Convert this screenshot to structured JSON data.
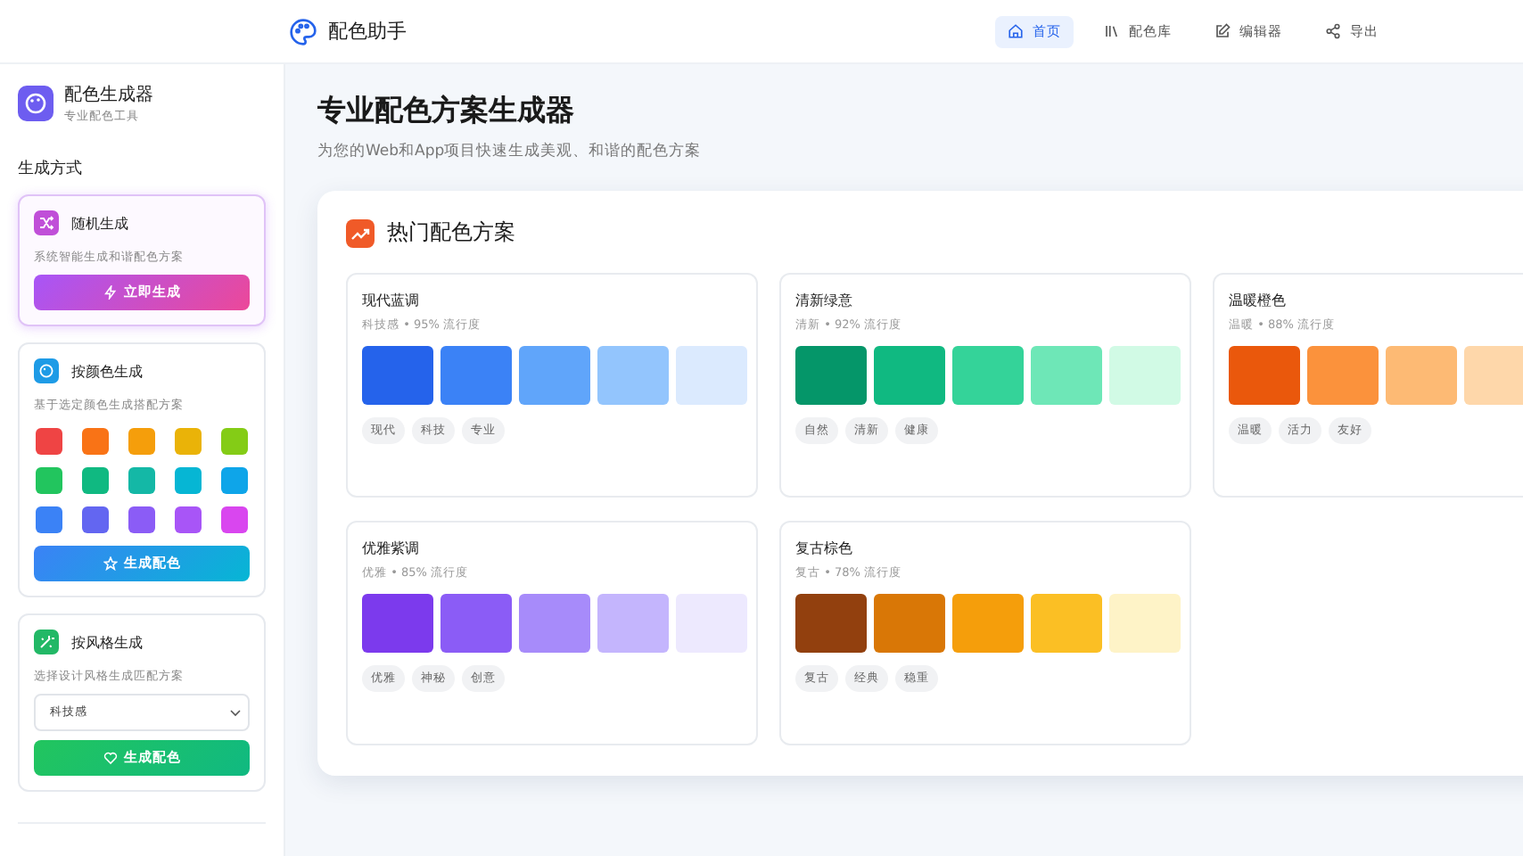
{
  "nav": {
    "brand": "配色助手",
    "items": [
      {
        "label": "首页",
        "selected": true
      },
      {
        "label": "配色库",
        "selected": false
      },
      {
        "label": "编辑器",
        "selected": false
      },
      {
        "label": "导出",
        "selected": false
      }
    ]
  },
  "sidebar": {
    "title": "配色生成器",
    "subtitle": "专业配色工具",
    "section_title": "生成方式",
    "methods": [
      {
        "kind": "random",
        "title": "随机生成",
        "description": "系统智能生成和谐配色方案",
        "button": "立即生成",
        "selected": true
      },
      {
        "kind": "color",
        "title": "按颜色生成",
        "description": "基于选定颜色生成搭配方案",
        "swatches": [
          {
            "color": "#ef4444"
          },
          {
            "color": "#f97316"
          },
          {
            "color": "#f59e0b"
          },
          {
            "color": "#eab308"
          },
          {
            "color": "#84cc16"
          },
          {
            "color": "#22c55e"
          },
          {
            "color": "#10b981"
          },
          {
            "color": "#14b8a6"
          },
          {
            "color": "#06b6d4"
          },
          {
            "color": "#0ea5e9"
          },
          {
            "color": "#3b82f6"
          },
          {
            "color": "#6366f1"
          },
          {
            "color": "#8b5cf6"
          },
          {
            "color": "#a855f7"
          },
          {
            "color": "#d946ef"
          }
        ],
        "button": "生成配色",
        "selected": false
      },
      {
        "kind": "style",
        "title": "按风格生成",
        "description": "选择设计风格生成匹配方案",
        "select": {
          "value": "科技感"
        },
        "button": "生成配色",
        "selected": false
      }
    ]
  },
  "main": {
    "title": "专业配色方案生成器",
    "subtitle": "为您的Web和App项目快速生成美观、和谐的配色方案",
    "panel": {
      "title": "热门配色方案",
      "schemes": [
        {
          "name": "现代蓝调",
          "meta": "科技感 • 95% 流行度",
          "colors": [
            {
              "color": "#2563eb"
            },
            {
              "color": "#3b82f6"
            },
            {
              "color": "#60a5fa"
            },
            {
              "color": "#93c5fd"
            },
            {
              "color": "#dbeafe"
            }
          ],
          "tags": [
            "现代",
            "科技",
            "专业"
          ]
        },
        {
          "name": "清新绿意",
          "meta": "清新 • 92% 流行度",
          "colors": [
            {
              "color": "#059669"
            },
            {
              "color": "#10b981"
            },
            {
              "color": "#34d399"
            },
            {
              "color": "#6ee7b7"
            },
            {
              "color": "#d1fae5"
            }
          ],
          "tags": [
            "自然",
            "清新",
            "健康"
          ]
        },
        {
          "name": "温暖橙色",
          "meta": "温暖 • 88% 流行度",
          "colors": [
            {
              "color": "#ea580c"
            },
            {
              "color": "#fb923c"
            },
            {
              "color": "#fdba74"
            },
            {
              "color": "#fed7aa"
            }
          ],
          "tags": [
            "温暖",
            "活力",
            "友好"
          ]
        },
        {
          "name": "优雅紫调",
          "meta": "优雅 • 85% 流行度",
          "colors": [
            {
              "color": "#7c3aed"
            },
            {
              "color": "#8b5cf6"
            },
            {
              "color": "#a78bfa"
            },
            {
              "color": "#c4b5fd"
            },
            {
              "color": "#ede9fe"
            }
          ],
          "tags": [
            "优雅",
            "神秘",
            "创意"
          ]
        },
        {
          "name": "复古棕色",
          "meta": "复古 • 78% 流行度",
          "colors": [
            {
              "color": "#92400e"
            },
            {
              "color": "#d97706"
            },
            {
              "color": "#f59e0b"
            },
            {
              "color": "#fbbf24"
            },
            {
              "color": "#fef3c7"
            }
          ],
          "tags": [
            "复古",
            "经典",
            "稳重"
          ]
        }
      ]
    }
  }
}
